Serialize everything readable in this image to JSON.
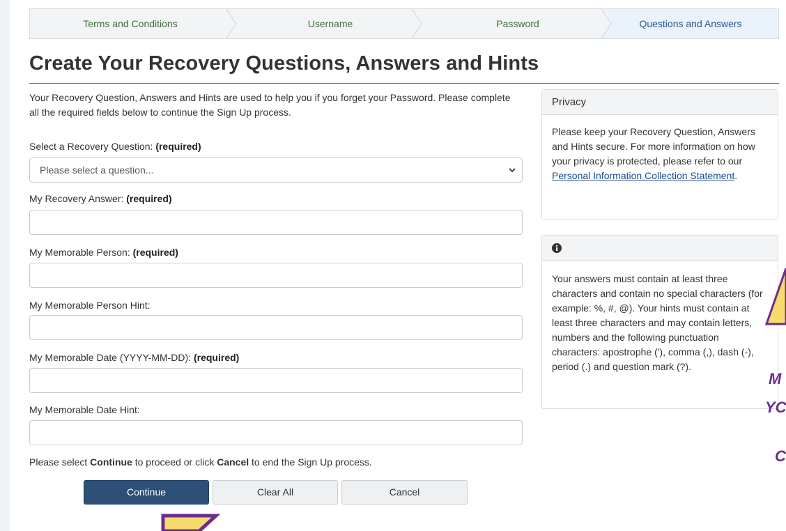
{
  "stepper": {
    "steps": [
      "Terms and Conditions",
      "Username",
      "Password",
      "Questions and Answers"
    ],
    "active_index": 3
  },
  "page_title": "Create Your Recovery Questions, Answers and Hints",
  "intro": "Your Recovery Question, Answers and Hints are used to help you if you forget your Password. Please complete all the required fields below to continue the Sign Up process.",
  "form": {
    "question_label": "Select a Recovery Question:",
    "question_placeholder": "Please select a question...",
    "answer_label": "My Recovery Answer:",
    "person_label": "My Memorable Person:",
    "person_hint_label": "My Memorable Person Hint:",
    "date_label": "My Memorable Date (YYYY-MM-DD):",
    "date_hint_label": "My Memorable Date Hint:",
    "required_text": "(required)"
  },
  "note": {
    "pre": "Please select ",
    "continue_word": "Continue",
    "mid": " to proceed or click ",
    "cancel_word": "Cancel",
    "post": " to end the Sign Up process."
  },
  "buttons": {
    "continue": "Continue",
    "clear_all": "Clear All",
    "cancel": "Cancel"
  },
  "privacy_panel": {
    "title": "Privacy",
    "body": "Please keep your Recovery Question, Answers and Hints secure. For more information on how your privacy is protected, please refer to our ",
    "link": "Personal Information Collection Statement",
    "end": "."
  },
  "info_panel": {
    "icon": "info-circle-icon",
    "body": "Your answers must contain at least three characters and contain no special characters (for example: %, #, @). Your hints must contain at least three characters and may contain letters, numbers and the following punctuation characters: apostrophe ('), comma (,), dash (-), period (.) and question mark (?)."
  },
  "overlay_text": [
    "M",
    "YC",
    "C"
  ],
  "colors": {
    "primary_button": "#2d5079",
    "title_rule": "#b83c3c",
    "link": "#1c4f8a",
    "annotation_purple": "#6b2d8f",
    "annotation_yellow": "#f5dc6b"
  }
}
